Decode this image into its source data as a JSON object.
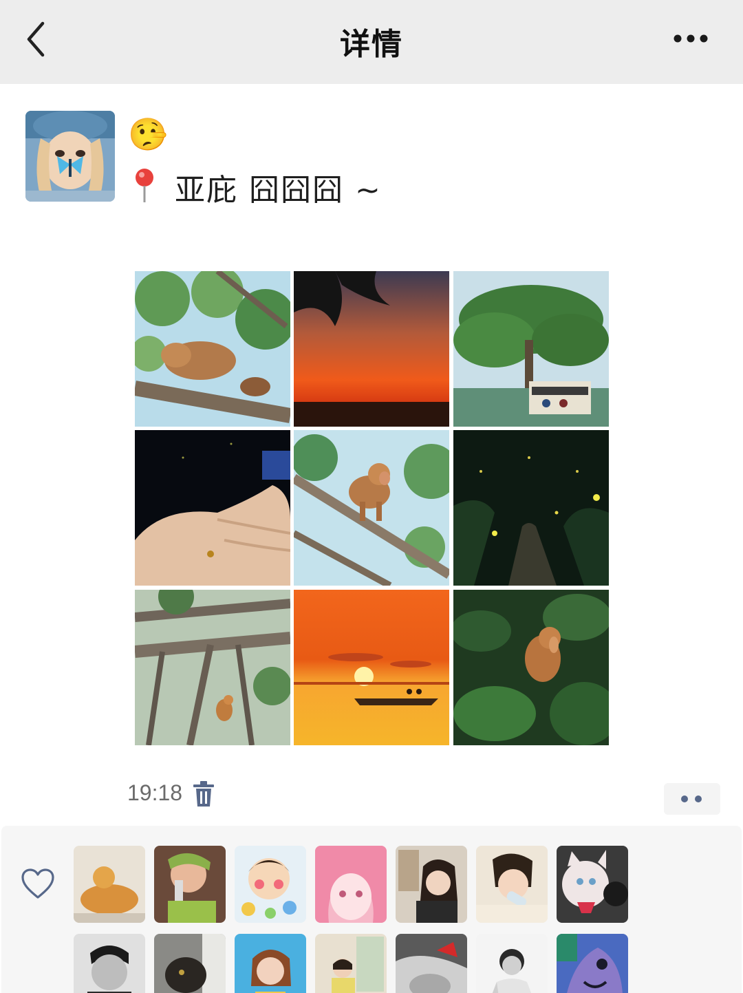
{
  "header": {
    "title": "详情",
    "back_icon": "chevron-left-icon",
    "more_icon": "more-horizontal-icon"
  },
  "post": {
    "emoji": "🤥",
    "location_icon": "map-pin-icon",
    "text": "亚庇  囧囧囧 ~",
    "photos": [
      "monkey-on-branch",
      "sunset-palm",
      "big-tree-boat",
      "firefly-hand",
      "proboscis-monkey",
      "fireflies-path",
      "monkey-in-trees",
      "sunset-boat",
      "monkey-in-leaves"
    ],
    "timestamp": "19:18",
    "delete_icon": "trash-icon",
    "comment_icon": "ellipsis-icon"
  },
  "likes": {
    "icon": "heart-outline-icon",
    "avatars_row1": [
      "cat-orange",
      "boy-phone",
      "cartoon-girl",
      "pink-anime",
      "girl-drink",
      "baby-bottle",
      "cat-white"
    ],
    "avatars_row2": [
      "man-bw",
      "cat-dark",
      "woman-blue",
      "girl-window",
      "bw-hand",
      "man-white",
      "purple-cartoon"
    ]
  },
  "colors": {
    "header_bg": "#ededed",
    "panel_bg": "#f6f6f6",
    "link_blue": "#57688a",
    "text_gray": "#6b6b6b"
  }
}
